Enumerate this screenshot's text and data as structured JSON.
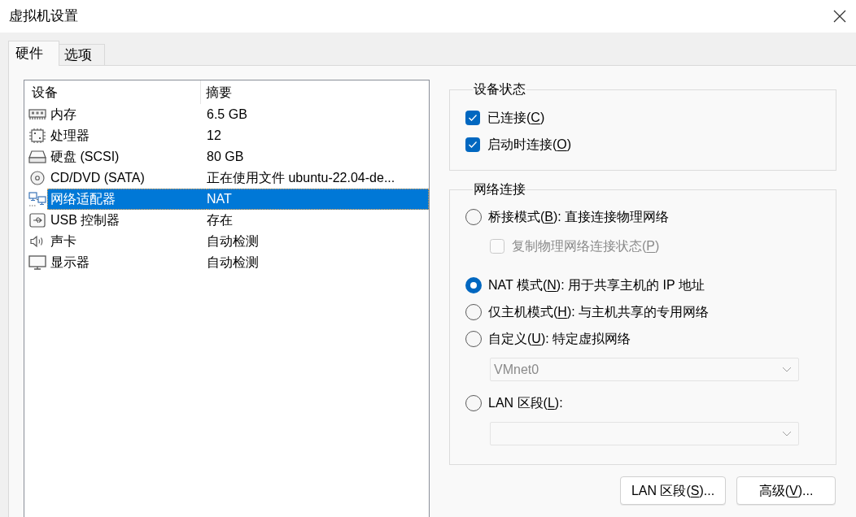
{
  "window": {
    "title": "虚拟机设置"
  },
  "tabs": [
    {
      "label": "硬件",
      "selected": true
    },
    {
      "label": "选项",
      "selected": false
    }
  ],
  "device_list": {
    "columns": [
      "设备",
      "摘要"
    ],
    "rows": [
      {
        "kind": "memory",
        "device": "内存",
        "summary": "6.5 GB",
        "selected": false
      },
      {
        "kind": "processor",
        "device": "处理器",
        "summary": "12",
        "selected": false
      },
      {
        "kind": "disk",
        "device": "硬盘 (SCSI)",
        "summary": "80 GB",
        "selected": false
      },
      {
        "kind": "cd",
        "device": "CD/DVD (SATA)",
        "summary": "正在使用文件 ubuntu-22.04-de...",
        "selected": false
      },
      {
        "kind": "network",
        "device": "网络适配器",
        "summary": "NAT",
        "selected": true
      },
      {
        "kind": "usb",
        "device": "USB 控制器",
        "summary": "存在",
        "selected": false
      },
      {
        "kind": "sound",
        "device": "声卡",
        "summary": "自动检测",
        "selected": false
      },
      {
        "kind": "display",
        "device": "显示器",
        "summary": "自动检测",
        "selected": false
      }
    ]
  },
  "device_status": {
    "title": "设备状态",
    "options": [
      {
        "label": [
          "已连接(",
          "C",
          ")"
        ],
        "checked": true
      },
      {
        "label": [
          "启动时连接(",
          "O",
          ")"
        ],
        "checked": true
      }
    ]
  },
  "network_connection": {
    "title": "网络连接",
    "items": [
      {
        "kind": "radio",
        "label": [
          "桥接模式(",
          "B",
          "): 直接连接物理网络"
        ],
        "selected": false
      },
      {
        "kind": "checkbox",
        "label": [
          "复制物理网络连接状态(",
          "P",
          ")"
        ],
        "checked": false,
        "disabled": true
      },
      {
        "kind": "radio",
        "label": [
          "NAT 模式(",
          "N",
          "): 用于共享主机的 IP 地址"
        ],
        "selected": true
      },
      {
        "kind": "radio",
        "label": [
          "仅主机模式(",
          "H",
          "): 与主机共享的专用网络"
        ],
        "selected": false
      },
      {
        "kind": "radio",
        "label": [
          "自定义(",
          "U",
          "): 特定虚拟网络"
        ],
        "selected": false
      },
      {
        "kind": "dropdown",
        "value": "VMnet0",
        "disabled": true
      },
      {
        "kind": "radio",
        "label": [
          "LAN 区段(",
          "L",
          "):"
        ],
        "selected": false
      },
      {
        "kind": "dropdown",
        "disabled": true
      }
    ]
  },
  "buttons": [
    {
      "label": [
        "LAN 区段(",
        "S",
        ")..."
      ]
    },
    {
      "label": [
        "高级(",
        "V",
        ")..."
      ]
    }
  ]
}
